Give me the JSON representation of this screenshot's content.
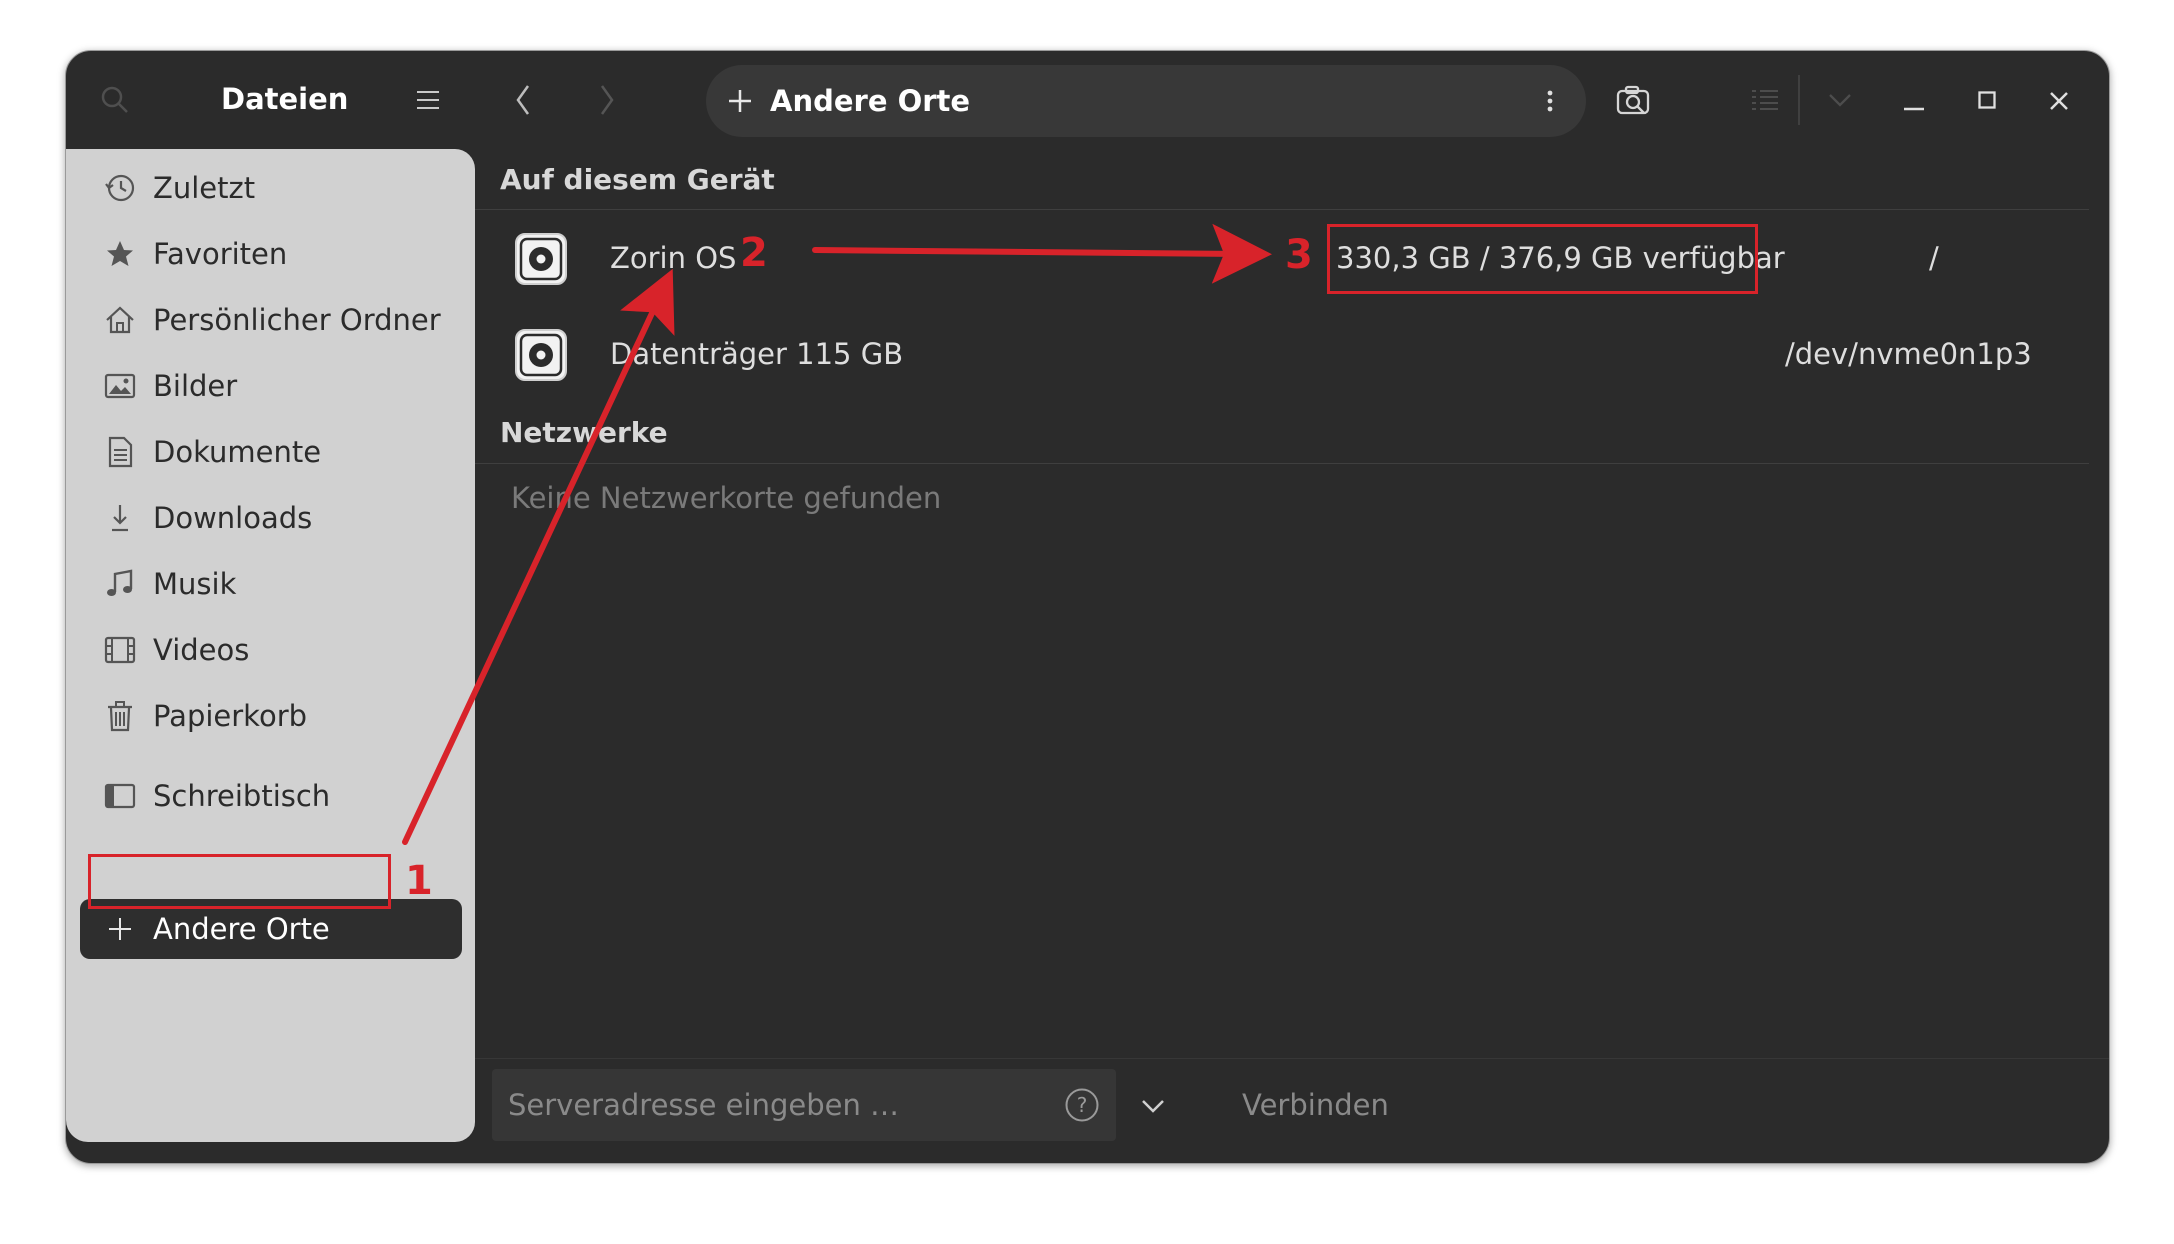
{
  "header": {
    "app_title": "Dateien",
    "location_label": "Andere Orte"
  },
  "sidebar": {
    "items": [
      {
        "label": "Zuletzt",
        "icon": "clock-icon"
      },
      {
        "label": "Favoriten",
        "icon": "star-icon"
      },
      {
        "label": "Persönlicher Ordner",
        "icon": "home-icon"
      },
      {
        "label": "Bilder",
        "icon": "image-icon"
      },
      {
        "label": "Dokumente",
        "icon": "document-icon"
      },
      {
        "label": "Downloads",
        "icon": "download-icon"
      },
      {
        "label": "Musik",
        "icon": "music-icon"
      },
      {
        "label": "Videos",
        "icon": "film-icon"
      },
      {
        "label": "Papierkorb",
        "icon": "trash-icon"
      }
    ],
    "desktop": {
      "label": "Schreibtisch",
      "icon": "desktop-icon"
    },
    "other_places": {
      "label": "Andere Orte",
      "icon": "plus-icon"
    }
  },
  "main": {
    "device_section": "Auf diesem Gerät",
    "devices": [
      {
        "name": "Zorin OS",
        "space": "330,3 GB / 376,9 GB verfügbar",
        "path": "/"
      },
      {
        "name": "Datenträger 115 GB",
        "space": "",
        "path": "/dev/nvme0n1p3"
      }
    ],
    "network_section": "Netzwerke",
    "network_empty": "Keine Netzwerkorte gefunden"
  },
  "footer": {
    "server_placeholder": "Serveradresse eingeben …",
    "connect_label": "Verbinden"
  },
  "annotations": {
    "n1": "1",
    "n2": "2",
    "n3": "3",
    "color": "#d8232a"
  },
  "colors": {
    "window_bg": "#2b2b2b",
    "sidebar_bg": "#d1d1d1",
    "text_light": "#dedede",
    "text_dark": "#2b2b2b"
  }
}
